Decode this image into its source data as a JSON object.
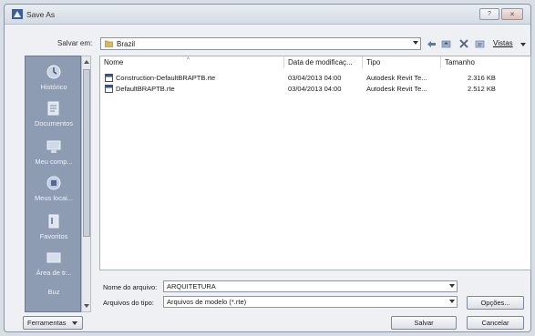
{
  "window": {
    "title": "Save As",
    "help_label": "?",
    "close_label": "✕"
  },
  "toolbar": {
    "save_in_label": "Salvar em:",
    "current_folder": "Brazil",
    "views_label": "Vistas"
  },
  "places": [
    {
      "label": "Histórico",
      "icon": "history-icon"
    },
    {
      "label": "Documentos",
      "icon": "documents-icon"
    },
    {
      "label": "Meu comp...",
      "icon": "computer-icon"
    },
    {
      "label": "Meus locai...",
      "icon": "network-icon"
    },
    {
      "label": "Favoritos",
      "icon": "favorites-icon"
    },
    {
      "label": "Área de tr...",
      "icon": "desktop-icon"
    },
    {
      "label": "Buz",
      "icon": "buzzsaw-icon"
    }
  ],
  "file_list": {
    "columns": [
      "Nome",
      "Data de modificaç...",
      "Tipo",
      "Tamanho"
    ],
    "rows": [
      {
        "name": "Construction-DefaultBRAPTB.rte",
        "date": "03/04/2013 04:00",
        "type": "Autodesk Revit Te...",
        "size": "2.316 KB"
      },
      {
        "name": "DefaultBRAPTB.rte",
        "date": "03/04/2013 04:00",
        "type": "Autodesk Revit Te...",
        "size": "2.512 KB"
      }
    ]
  },
  "form": {
    "file_name_label": "Nome do arquivo:",
    "file_name_value": "ARQUITETURA",
    "file_type_label": "Arquivos do tipo:",
    "file_type_value": "Arquivos de modelo  (*.rte)"
  },
  "buttons": {
    "options": "Opções...",
    "save": "Salvar",
    "cancel": "Cancelar",
    "tools": "Ferramentas"
  }
}
